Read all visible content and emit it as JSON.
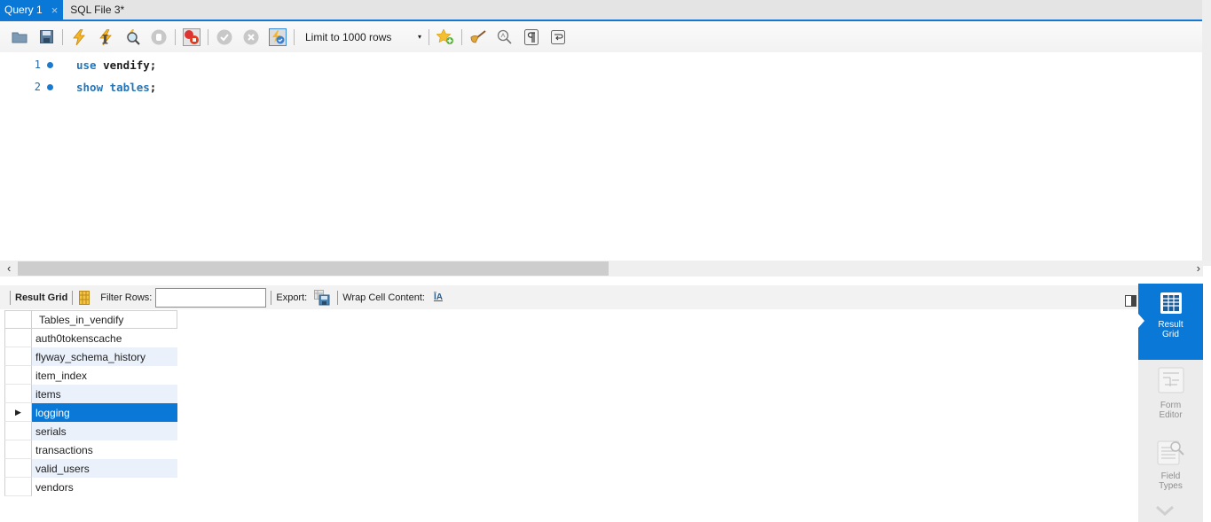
{
  "tabs": [
    {
      "label": "Query 1",
      "active": true,
      "close": "×"
    },
    {
      "label": "SQL File 3*",
      "active": false
    }
  ],
  "toolbar": {
    "icons": [
      "open-folder-icon",
      "save-icon",
      "execute-icon",
      "execute-current-icon",
      "explain-icon",
      "stop-icon",
      "toggle-error-stop-icon",
      "commit-icon",
      "rollback-icon",
      "autocommit-icon"
    ],
    "limit_label": "Limit to 1000 rows",
    "limit_arrow": "▾",
    "extra_icons": [
      "add-snippet-icon",
      "beautify-icon",
      "find-icon",
      "invisible-chars-icon",
      "wrap-icon"
    ]
  },
  "editor": {
    "lines": [
      {
        "num": "1",
        "keyword": "use",
        "rest": " vendify;"
      },
      {
        "num": "2",
        "keyword": "show tables",
        "rest": ";"
      }
    ]
  },
  "hscroll": {
    "left": "‹",
    "right": "›"
  },
  "result_toolbar": {
    "result_grid_label": "Result Grid",
    "filter_label": "Filter Rows:",
    "filter_value": "",
    "export_label": "Export:",
    "wrap_label": "Wrap Cell Content:",
    "wrap_icon_glyph": "ĪA"
  },
  "grid": {
    "column": "Tables_in_vendify",
    "rows": [
      "auth0tokenscache",
      "flyway_schema_history",
      "item_index",
      "items",
      "logging",
      "serials",
      "transactions",
      "valid_users",
      "vendors"
    ],
    "selected_index": 4,
    "row_marker": "▶"
  },
  "side_panel": {
    "items": [
      {
        "label_1": "Result",
        "label_2": "Grid",
        "active": true
      },
      {
        "label_1": "Form",
        "label_2": "Editor",
        "active": false
      },
      {
        "label_1": "Field",
        "label_2": "Types",
        "active": false
      }
    ]
  },
  "colors": {
    "accent": "#0a78d7",
    "keyword": "#2576b8",
    "alt_row": "#eaf1fb"
  }
}
